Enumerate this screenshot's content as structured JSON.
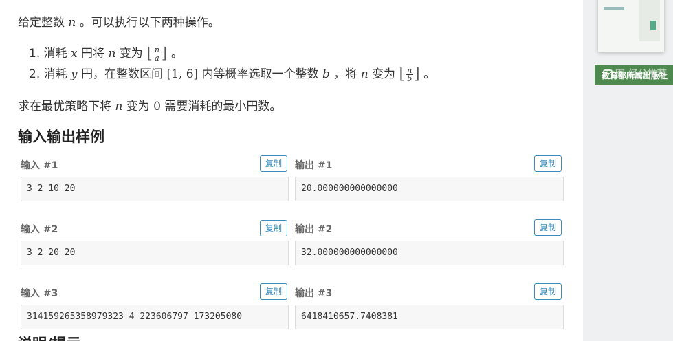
{
  "statement": {
    "line1_pre": "给定整数",
    "var_n": "n",
    "line1_post": "。可以执行以下两种操作。",
    "op1": {
      "num": "1.",
      "pre": "消耗",
      "var": "x",
      "mid": "円将",
      "mid2": "变为",
      "frac_num": "n",
      "frac_den": "a",
      "post": "。"
    },
    "op2": {
      "num": "2.",
      "pre": "消耗",
      "var": "y",
      "mid": "円，在整数区间",
      "interval": "[1, 6]",
      "mid2": "内等概率选取一个整数",
      "var_b": "b",
      "mid3": "，将",
      "mid4": "变为",
      "frac_num": "n",
      "frac_den": "b",
      "post": "。"
    },
    "line3_pre": "求在最优策略下将",
    "line3_mid": "变为",
    "zero": "0",
    "line3_post": "需要消耗的最小円数。"
  },
  "samples_title": "输入输出样例",
  "copy_label": "复制",
  "samples": [
    {
      "in_label": "输入 #1",
      "out_label": "输出 #1",
      "input": "3 2 10 20",
      "output": "20.000000000000000"
    },
    {
      "in_label": "输入 #2",
      "out_label": "输出 #2",
      "input": "3 2 20 20",
      "output": "32.000000000000000"
    },
    {
      "in_label": "输入 #3",
      "out_label": "输出 #3",
      "input": "314159265358979323 4 223606797 173205080",
      "output": "6418410657.7408381"
    }
  ],
  "next_section_title": "说明/提示",
  "sidebar": {
    "banner_text": "教育部所属出版社",
    "banner_overlay": "图 经分推荐"
  }
}
